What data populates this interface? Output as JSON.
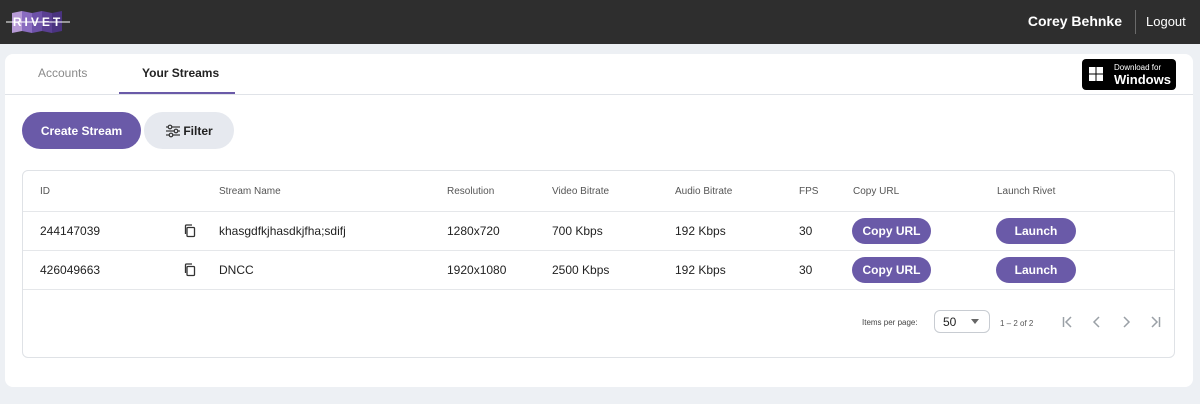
{
  "header": {
    "logo_text": "RIVET",
    "user_name": "Corey Behnke",
    "logout_label": "Logout"
  },
  "tabs": [
    {
      "label": "Accounts",
      "active": false
    },
    {
      "label": "Your Streams",
      "active": true
    }
  ],
  "download": {
    "sub_label": "Download for",
    "main_label": "Windows"
  },
  "actions": {
    "create_label": "Create Stream",
    "filter_label": "Filter"
  },
  "table": {
    "columns": [
      "ID",
      "Stream Name",
      "Resolution",
      "Video Bitrate",
      "Audio Bitrate",
      "FPS",
      "Copy URL",
      "Launch Rivet"
    ],
    "rows": [
      {
        "id": "244147039",
        "name": "khasgdfkjhasdkjfha;sdifj",
        "resolution": "1280x720",
        "video_bitrate": "700 Kbps",
        "audio_bitrate": "192 Kbps",
        "fps": "30",
        "copy_label": "Copy URL",
        "launch_label": "Launch"
      },
      {
        "id": "426049663",
        "name": "DNCC",
        "resolution": "1920x1080",
        "video_bitrate": "2500 Kbps",
        "audio_bitrate": "192 Kbps",
        "fps": "30",
        "copy_label": "Copy URL",
        "launch_label": "Launch"
      }
    ]
  },
  "pagination": {
    "items_per_page_label": "Items per page:",
    "items_per_page_value": "50",
    "range_label": "1 – 2 of 2"
  },
  "colors": {
    "accent": "#6a5aa8",
    "topbar": "#2e2e2e",
    "page_bg": "#edf0f4"
  },
  "icons": {
    "copy": "copy-icon",
    "filter": "sliders-icon",
    "windows": "windows-logo-icon",
    "first_page": "first-page-icon",
    "prev_page": "chevron-left-icon",
    "next_page": "chevron-right-icon",
    "last_page": "last-page-icon"
  }
}
